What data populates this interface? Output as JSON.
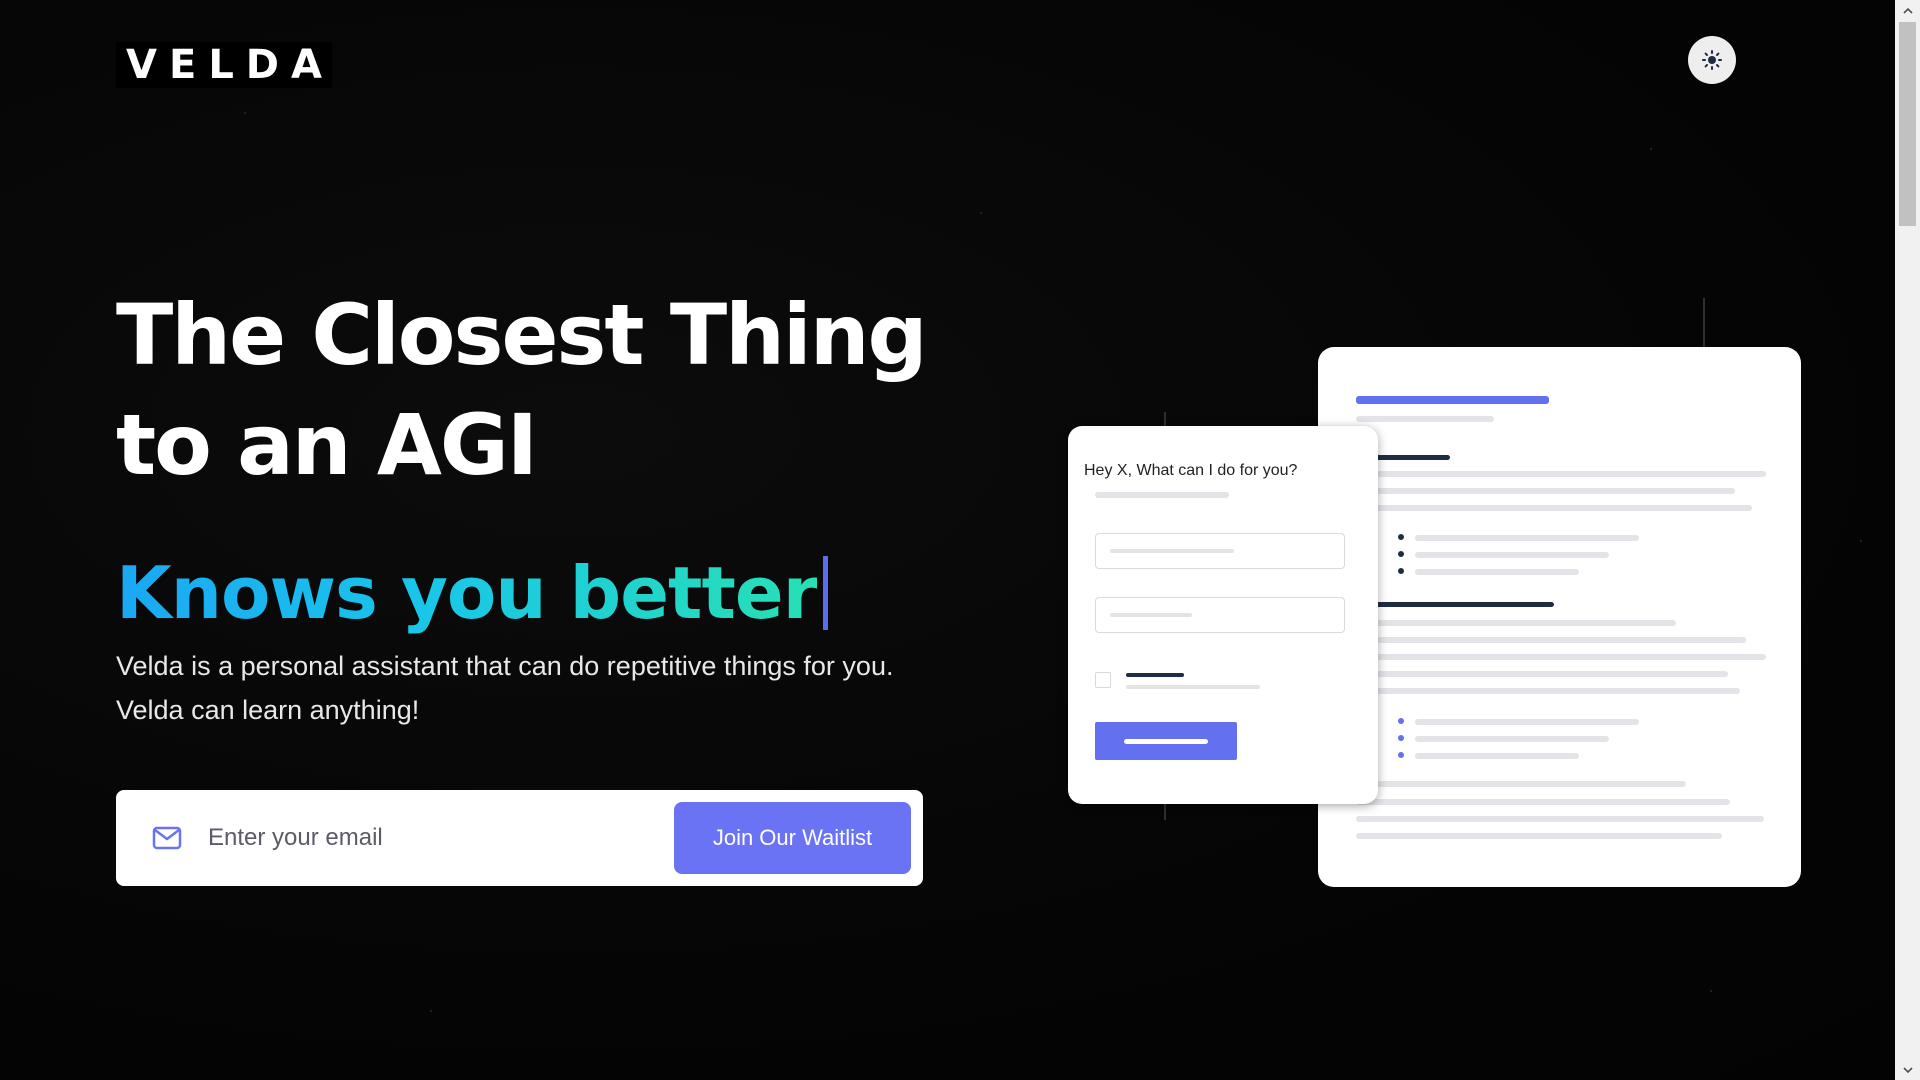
{
  "brand": {
    "logo_text": "VELDA"
  },
  "header": {
    "theme_toggle_icon": "sun-icon"
  },
  "hero": {
    "headline_line1": "The Closest Thing",
    "headline_line2": "to an AGI",
    "tagline": "Knows you better",
    "description": "Velda is a personal assistant that can do repetitive things for you. Velda can learn anything!"
  },
  "waitlist": {
    "mail_icon": "mail-icon",
    "email_placeholder": "Enter your email",
    "email_value": "",
    "join_button_label": "Join Our Waitlist"
  },
  "illustration": {
    "chat_prompt": "Hey X, What can I do for you?"
  },
  "colors": {
    "background": "#050505",
    "accent": "#6b73f5",
    "tagline_gradient_start": "#1aa7f5",
    "tagline_gradient_end": "#27e0b4",
    "caret": "#5b6cf0"
  }
}
